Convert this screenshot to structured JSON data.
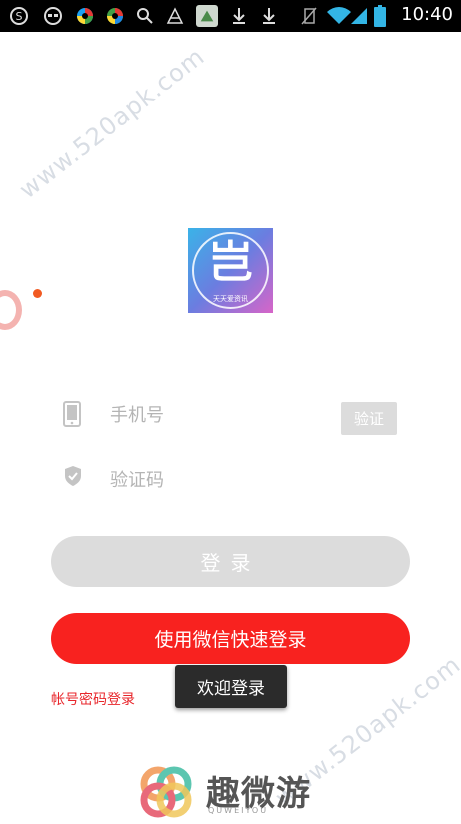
{
  "statusbar": {
    "time": "10:40",
    "icons": [
      "sogou-icon",
      "glasses-icon",
      "color-wheel-icon",
      "color-wheel-icon",
      "search-icon",
      "app-icon",
      "app-icon",
      "download-icon",
      "download-icon",
      "no-sim-icon",
      "wifi-icon",
      "signal-icon",
      "battery-icon"
    ]
  },
  "watermark": {
    "text": "www.520apk.com"
  },
  "logo": {
    "glyph": "岂",
    "subtitle": "天天爱资讯"
  },
  "form": {
    "phone_placeholder": "手机号",
    "code_placeholder": "验证码",
    "verify_label": "验证",
    "login_label": "登录",
    "wechat_label": "使用微信快速登录",
    "account_link": "帐号密码登录"
  },
  "toast": {
    "text": "欢迎登录"
  },
  "brand": {
    "name": "趣微游",
    "sub": "QUWEIYOU"
  },
  "colors": {
    "primary_red": "#f8221f",
    "disabled_gray": "#dcdcdc",
    "link_red": "#e8262b"
  }
}
